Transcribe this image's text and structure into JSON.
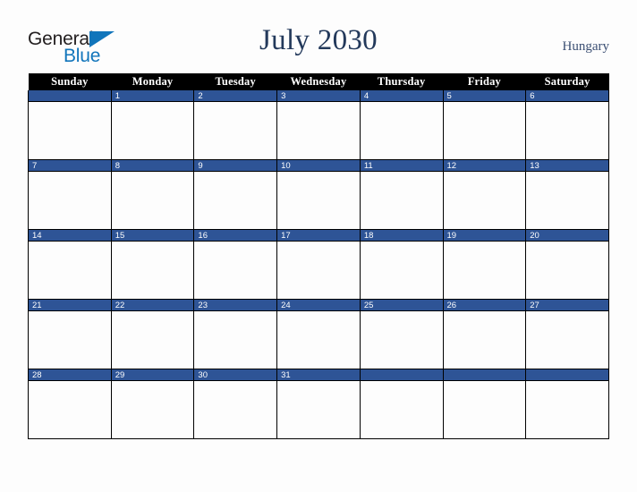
{
  "brand": {
    "line1": "General",
    "line2": "Blue",
    "triangle_color": "#1175bb",
    "line1_color": "#231f20",
    "line2_color": "#1175bb"
  },
  "header": {
    "title": "July 2030",
    "country": "Hungary",
    "title_color": "#23395b",
    "country_color": "#3b4f73"
  },
  "calendar": {
    "month": "July",
    "year": "2030",
    "header_bg": "#000000",
    "header_fg": "#ffffff",
    "daynum_bg": "#2e5496",
    "daynum_fg": "#ffffff",
    "weekdays": [
      "Sunday",
      "Monday",
      "Tuesday",
      "Wednesday",
      "Thursday",
      "Friday",
      "Saturday"
    ],
    "weeks": [
      [
        "",
        "1",
        "2",
        "3",
        "4",
        "5",
        "6"
      ],
      [
        "7",
        "8",
        "9",
        "10",
        "11",
        "12",
        "13"
      ],
      [
        "14",
        "15",
        "16",
        "17",
        "18",
        "19",
        "20"
      ],
      [
        "21",
        "22",
        "23",
        "24",
        "25",
        "26",
        "27"
      ],
      [
        "28",
        "29",
        "30",
        "31",
        "",
        "",
        ""
      ]
    ]
  }
}
